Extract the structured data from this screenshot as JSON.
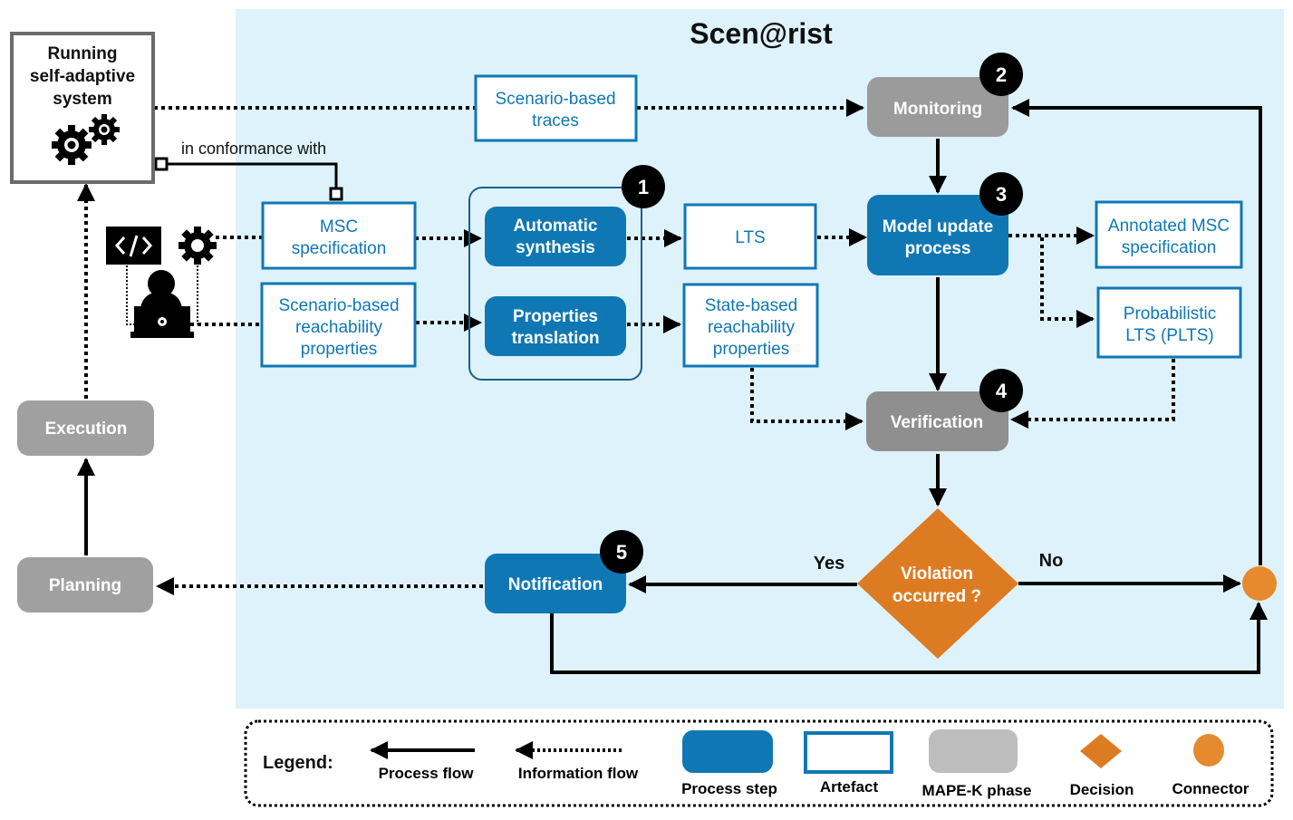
{
  "title": "Scen@rist",
  "colors": {
    "background_region": "#DDF2FB",
    "process_step": "#0F78B4",
    "artefact_border": "#0F78B4",
    "mape_phase": "#9B9B9B",
    "decision": "#DD7B22",
    "connector": "#E58A2E",
    "badge": "#000000"
  },
  "system": {
    "lines": [
      "Running",
      "self-adaptive",
      "system"
    ],
    "icon": "gears-icon"
  },
  "conformance_label": "in conformance with",
  "developer_icons": [
    "code-icon",
    "gear-icon",
    "developer-laptop-icon"
  ],
  "artefacts": {
    "scenario_traces": [
      "Scenario-based",
      "traces"
    ],
    "msc_spec": [
      "MSC",
      "specification"
    ],
    "scenario_props": [
      "Scenario-based",
      "reachability",
      "properties"
    ],
    "lts": [
      "LTS"
    ],
    "state_props": [
      "State-based",
      "reachability",
      "properties"
    ],
    "annotated_msc": [
      "Annotated MSC",
      "specification"
    ],
    "plts": [
      "Probabilistic",
      "LTS (PLTS)"
    ]
  },
  "steps": {
    "auto_synthesis": [
      "Automatic",
      "synthesis"
    ],
    "props_translation": [
      "Properties",
      "translation"
    ],
    "model_update": [
      "Model update",
      "process"
    ],
    "notification": [
      "Notification"
    ]
  },
  "phases": {
    "monitoring": "Monitoring",
    "verification": "Verification",
    "execution": "Execution",
    "planning": "Planning"
  },
  "badges": [
    "1",
    "2",
    "3",
    "4",
    "5"
  ],
  "decision": {
    "lines": [
      "Violation",
      "occurred ?"
    ],
    "yes": "Yes",
    "no": "No"
  },
  "legend": {
    "title": "Legend:",
    "process_flow": "Process flow",
    "information_flow": "Information flow",
    "process_step": "Process step",
    "artefact": "Artefact",
    "mape_k_phase": "MAPE-K phase",
    "decision": "Decision",
    "connector": "Connector"
  }
}
